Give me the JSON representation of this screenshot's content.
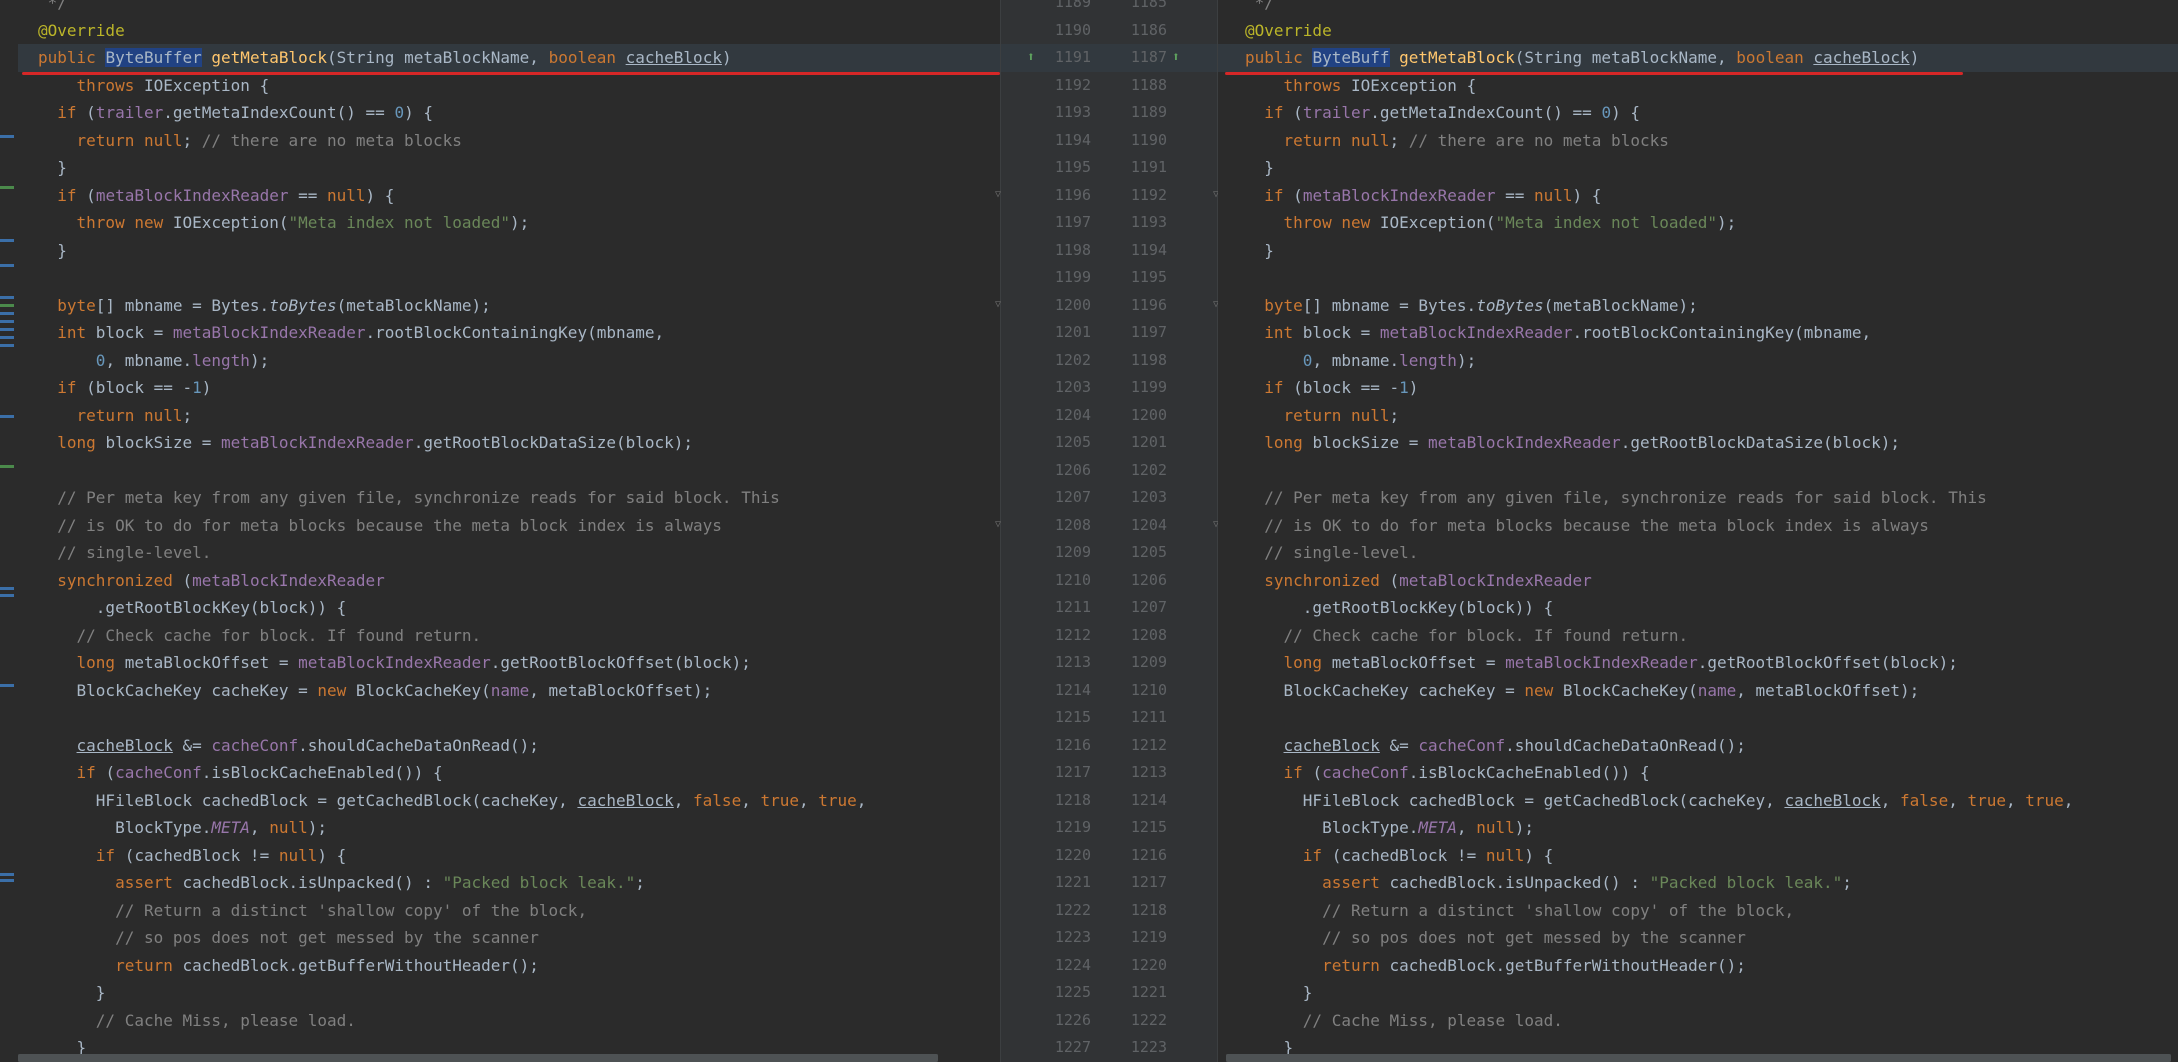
{
  "left": {
    "lines": [
      [
        {
          "t": " */",
          "c": "cm"
        }
      ],
      [
        {
          "t": "@Override",
          "c": "an"
        }
      ],
      [
        {
          "t": "public ",
          "c": "kw"
        },
        {
          "t": "ByteBuffer",
          "c": "sel"
        },
        {
          "t": " "
        },
        {
          "t": "getMetaBlock",
          "c": "fn"
        },
        {
          "t": "(String metaBlockName, "
        },
        {
          "t": "boolean ",
          "c": "kw"
        },
        {
          "t": "cacheBlock",
          "c": "ul"
        },
        {
          "t": ")"
        }
      ],
      [
        {
          "t": "    throws ",
          "c": "kw"
        },
        {
          "t": "IOException {"
        }
      ],
      [
        {
          "t": "  "
        },
        {
          "t": "if ",
          "c": "kw"
        },
        {
          "t": "("
        },
        {
          "t": "trailer",
          "c": "fld"
        },
        {
          "t": ".getMetaIndexCount() == "
        },
        {
          "t": "0",
          "c": "nm"
        },
        {
          "t": ") {"
        }
      ],
      [
        {
          "t": "    "
        },
        {
          "t": "return null",
          "c": "kw"
        },
        {
          "t": "; "
        },
        {
          "t": "// there are no meta blocks",
          "c": "cm"
        }
      ],
      [
        {
          "t": "  }"
        }
      ],
      [
        {
          "t": "  "
        },
        {
          "t": "if ",
          "c": "kw"
        },
        {
          "t": "("
        },
        {
          "t": "metaBlockIndexReader",
          "c": "fld"
        },
        {
          "t": " == "
        },
        {
          "t": "null",
          "c": "kw"
        },
        {
          "t": ") {"
        }
      ],
      [
        {
          "t": "    "
        },
        {
          "t": "throw new ",
          "c": "kw"
        },
        {
          "t": "IOException("
        },
        {
          "t": "\"Meta index not loaded\"",
          "c": "st"
        },
        {
          "t": ");"
        }
      ],
      [
        {
          "t": "  }"
        }
      ],
      [],
      [
        {
          "t": "  "
        },
        {
          "t": "byte",
          "c": "kw"
        },
        {
          "t": "[] mbname = Bytes."
        },
        {
          "t": "toBytes",
          "c": "it"
        },
        {
          "t": "(metaBlockName);"
        }
      ],
      [
        {
          "t": "  "
        },
        {
          "t": "int ",
          "c": "kw"
        },
        {
          "t": "block = "
        },
        {
          "t": "metaBlockIndexReader",
          "c": "fld"
        },
        {
          "t": ".rootBlockContainingKey(mbname,"
        }
      ],
      [
        {
          "t": "      "
        },
        {
          "t": "0",
          "c": "nm"
        },
        {
          "t": ", mbname."
        },
        {
          "t": "length",
          "c": "fld"
        },
        {
          "t": ");"
        }
      ],
      [
        {
          "t": "  "
        },
        {
          "t": "if ",
          "c": "kw"
        },
        {
          "t": "(block == -"
        },
        {
          "t": "1",
          "c": "nm"
        },
        {
          "t": ")"
        }
      ],
      [
        {
          "t": "    "
        },
        {
          "t": "return null",
          "c": "kw"
        },
        {
          "t": ";"
        }
      ],
      [
        {
          "t": "  "
        },
        {
          "t": "long ",
          "c": "kw"
        },
        {
          "t": "blockSize = "
        },
        {
          "t": "metaBlockIndexReader",
          "c": "fld"
        },
        {
          "t": ".getRootBlockDataSize(block);"
        }
      ],
      [],
      [
        {
          "t": "  "
        },
        {
          "t": "// Per meta key from any given file, synchronize reads for said block. This",
          "c": "cm"
        }
      ],
      [
        {
          "t": "  "
        },
        {
          "t": "// is OK to do for meta blocks because the meta block index is always",
          "c": "cm"
        }
      ],
      [
        {
          "t": "  "
        },
        {
          "t": "// single-level.",
          "c": "cm"
        }
      ],
      [
        {
          "t": "  "
        },
        {
          "t": "synchronized ",
          "c": "kw"
        },
        {
          "t": "("
        },
        {
          "t": "metaBlockIndexReader",
          "c": "fld"
        }
      ],
      [
        {
          "t": "      .getRootBlockKey(block)) {"
        }
      ],
      [
        {
          "t": "    "
        },
        {
          "t": "// Check cache for block. If found return.",
          "c": "cm"
        }
      ],
      [
        {
          "t": "    "
        },
        {
          "t": "long ",
          "c": "kw"
        },
        {
          "t": "metaBlockOffset = "
        },
        {
          "t": "metaBlockIndexReader",
          "c": "fld"
        },
        {
          "t": ".getRootBlockOffset(block);"
        }
      ],
      [
        {
          "t": "    BlockCacheKey cacheKey = "
        },
        {
          "t": "new ",
          "c": "kw"
        },
        {
          "t": "BlockCacheKey("
        },
        {
          "t": "name",
          "c": "fld"
        },
        {
          "t": ", metaBlockOffset);"
        }
      ],
      [],
      [
        {
          "t": "    "
        },
        {
          "t": "cacheBlock",
          "c": "ul"
        },
        {
          "t": " &= "
        },
        {
          "t": "cacheConf",
          "c": "fld"
        },
        {
          "t": ".shouldCacheDataOnRead();"
        }
      ],
      [
        {
          "t": "    "
        },
        {
          "t": "if ",
          "c": "kw"
        },
        {
          "t": "("
        },
        {
          "t": "cacheConf",
          "c": "fld"
        },
        {
          "t": ".isBlockCacheEnabled()) {"
        }
      ],
      [
        {
          "t": "      HFileBlock cachedBlock = getCachedBlock(cacheKey, "
        },
        {
          "t": "cacheBlock",
          "c": "ul"
        },
        {
          "t": ", "
        },
        {
          "t": "false",
          "c": "kw"
        },
        {
          "t": ", "
        },
        {
          "t": "true",
          "c": "kw"
        },
        {
          "t": ", "
        },
        {
          "t": "true",
          "c": "kw"
        },
        {
          "t": ","
        }
      ],
      [
        {
          "t": "        BlockType."
        },
        {
          "t": "META",
          "c": "fld it"
        },
        {
          "t": ", "
        },
        {
          "t": "null",
          "c": "kw"
        },
        {
          "t": ");"
        }
      ],
      [
        {
          "t": "      "
        },
        {
          "t": "if ",
          "c": "kw"
        },
        {
          "t": "(cachedBlock != "
        },
        {
          "t": "null",
          "c": "kw"
        },
        {
          "t": ") {"
        }
      ],
      [
        {
          "t": "        "
        },
        {
          "t": "assert ",
          "c": "kw"
        },
        {
          "t": "cachedBlock.isUnpacked() : "
        },
        {
          "t": "\"Packed block leak.\"",
          "c": "st"
        },
        {
          "t": ";"
        }
      ],
      [
        {
          "t": "        "
        },
        {
          "t": "// Return a distinct 'shallow copy' of the block,",
          "c": "cm"
        }
      ],
      [
        {
          "t": "        "
        },
        {
          "t": "// so pos does not get messed by the scanner",
          "c": "cm"
        }
      ],
      [
        {
          "t": "        "
        },
        {
          "t": "return ",
          "c": "kw"
        },
        {
          "t": "cachedBlock.getBufferWithoutHeader();"
        }
      ],
      [
        {
          "t": "      }"
        }
      ],
      [
        {
          "t": "      "
        },
        {
          "t": "// Cache Miss, please load.",
          "c": "cm"
        }
      ],
      [
        {
          "t": "    }"
        }
      ]
    ]
  },
  "right": {
    "lines": [
      [
        {
          "t": " */",
          "c": "cm"
        }
      ],
      [
        {
          "t": "@Override",
          "c": "an"
        }
      ],
      [
        {
          "t": "public ",
          "c": "kw"
        },
        {
          "t": "ByteBuff",
          "c": "sel"
        },
        {
          "t": " "
        },
        {
          "t": "getMetaBlock",
          "c": "fn"
        },
        {
          "t": "(String metaBlockName, "
        },
        {
          "t": "boolean ",
          "c": "kw"
        },
        {
          "t": "cacheBlock",
          "c": "ul"
        },
        {
          "t": ")"
        }
      ],
      [
        {
          "t": "    throws ",
          "c": "kw"
        },
        {
          "t": "IOException {"
        }
      ],
      [
        {
          "t": "  "
        },
        {
          "t": "if ",
          "c": "kw"
        },
        {
          "t": "("
        },
        {
          "t": "trailer",
          "c": "fld"
        },
        {
          "t": ".getMetaIndexCount() == "
        },
        {
          "t": "0",
          "c": "nm"
        },
        {
          "t": ") {"
        }
      ],
      [
        {
          "t": "    "
        },
        {
          "t": "return null",
          "c": "kw"
        },
        {
          "t": "; "
        },
        {
          "t": "// there are no meta blocks",
          "c": "cm"
        }
      ],
      [
        {
          "t": "  }"
        }
      ],
      [
        {
          "t": "  "
        },
        {
          "t": "if ",
          "c": "kw"
        },
        {
          "t": "("
        },
        {
          "t": "metaBlockIndexReader",
          "c": "fld"
        },
        {
          "t": " == "
        },
        {
          "t": "null",
          "c": "kw"
        },
        {
          "t": ") {"
        }
      ],
      [
        {
          "t": "    "
        },
        {
          "t": "throw new ",
          "c": "kw"
        },
        {
          "t": "IOException("
        },
        {
          "t": "\"Meta index not loaded\"",
          "c": "st"
        },
        {
          "t": ");"
        }
      ],
      [
        {
          "t": "  }"
        }
      ],
      [],
      [
        {
          "t": "  "
        },
        {
          "t": "byte",
          "c": "kw"
        },
        {
          "t": "[] mbname = Bytes."
        },
        {
          "t": "toBytes",
          "c": "it"
        },
        {
          "t": "(metaBlockName);"
        }
      ],
      [
        {
          "t": "  "
        },
        {
          "t": "int ",
          "c": "kw"
        },
        {
          "t": "block = "
        },
        {
          "t": "metaBlockIndexReader",
          "c": "fld"
        },
        {
          "t": ".rootBlockContainingKey(mbname,"
        }
      ],
      [
        {
          "t": "      "
        },
        {
          "t": "0",
          "c": "nm"
        },
        {
          "t": ", mbname."
        },
        {
          "t": "length",
          "c": "fld"
        },
        {
          "t": ");"
        }
      ],
      [
        {
          "t": "  "
        },
        {
          "t": "if ",
          "c": "kw"
        },
        {
          "t": "(block == -"
        },
        {
          "t": "1",
          "c": "nm"
        },
        {
          "t": ")"
        }
      ],
      [
        {
          "t": "    "
        },
        {
          "t": "return null",
          "c": "kw"
        },
        {
          "t": ";"
        }
      ],
      [
        {
          "t": "  "
        },
        {
          "t": "long ",
          "c": "kw"
        },
        {
          "t": "blockSize = "
        },
        {
          "t": "metaBlockIndexReader",
          "c": "fld"
        },
        {
          "t": ".getRootBlockDataSize(block);"
        }
      ],
      [],
      [
        {
          "t": "  "
        },
        {
          "t": "// Per meta key from any given file, synchronize reads for said block. This",
          "c": "cm"
        }
      ],
      [
        {
          "t": "  "
        },
        {
          "t": "// is OK to do for meta blocks because the meta block index is always",
          "c": "cm"
        }
      ],
      [
        {
          "t": "  "
        },
        {
          "t": "// single-level.",
          "c": "cm"
        }
      ],
      [
        {
          "t": "  "
        },
        {
          "t": "synchronized ",
          "c": "kw"
        },
        {
          "t": "("
        },
        {
          "t": "metaBlockIndexReader",
          "c": "fld"
        }
      ],
      [
        {
          "t": "      .getRootBlockKey(block)) {"
        }
      ],
      [
        {
          "t": "    "
        },
        {
          "t": "// Check cache for block. If found return.",
          "c": "cm"
        }
      ],
      [
        {
          "t": "    "
        },
        {
          "t": "long ",
          "c": "kw"
        },
        {
          "t": "metaBlockOffset = "
        },
        {
          "t": "metaBlockIndexReader",
          "c": "fld"
        },
        {
          "t": ".getRootBlockOffset(block);"
        }
      ],
      [
        {
          "t": "    BlockCacheKey cacheKey = "
        },
        {
          "t": "new ",
          "c": "kw"
        },
        {
          "t": "BlockCacheKey("
        },
        {
          "t": "name",
          "c": "fld"
        },
        {
          "t": ", metaBlockOffset);"
        }
      ],
      [],
      [
        {
          "t": "    "
        },
        {
          "t": "cacheBlock",
          "c": "ul"
        },
        {
          "t": " &= "
        },
        {
          "t": "cacheConf",
          "c": "fld"
        },
        {
          "t": ".shouldCacheDataOnRead();"
        }
      ],
      [
        {
          "t": "    "
        },
        {
          "t": "if ",
          "c": "kw"
        },
        {
          "t": "("
        },
        {
          "t": "cacheConf",
          "c": "fld"
        },
        {
          "t": ".isBlockCacheEnabled()) {"
        }
      ],
      [
        {
          "t": "      HFileBlock cachedBlock = getCachedBlock(cacheKey, "
        },
        {
          "t": "cacheBlock",
          "c": "ul"
        },
        {
          "t": ", "
        },
        {
          "t": "false",
          "c": "kw"
        },
        {
          "t": ", "
        },
        {
          "t": "true",
          "c": "kw"
        },
        {
          "t": ", "
        },
        {
          "t": "true",
          "c": "kw"
        },
        {
          "t": ","
        }
      ],
      [
        {
          "t": "        BlockType."
        },
        {
          "t": "META",
          "c": "fld it"
        },
        {
          "t": ", "
        },
        {
          "t": "null",
          "c": "kw"
        },
        {
          "t": ");"
        }
      ],
      [
        {
          "t": "      "
        },
        {
          "t": "if ",
          "c": "kw"
        },
        {
          "t": "(cachedBlock != "
        },
        {
          "t": "null",
          "c": "kw"
        },
        {
          "t": ") {"
        }
      ],
      [
        {
          "t": "        "
        },
        {
          "t": "assert ",
          "c": "kw"
        },
        {
          "t": "cachedBlock.isUnpacked() : "
        },
        {
          "t": "\"Packed block leak.\"",
          "c": "st"
        },
        {
          "t": ";"
        }
      ],
      [
        {
          "t": "        "
        },
        {
          "t": "// Return a distinct 'shallow copy' of the block,",
          "c": "cm"
        }
      ],
      [
        {
          "t": "        "
        },
        {
          "t": "// so pos does not get messed by the scanner",
          "c": "cm"
        }
      ],
      [
        {
          "t": "        "
        },
        {
          "t": "return ",
          "c": "kw"
        },
        {
          "t": "cachedBlock.getBufferWithoutHeader();"
        }
      ],
      [
        {
          "t": "      }"
        }
      ],
      [
        {
          "t": "      "
        },
        {
          "t": "// Cache Miss, please load.",
          "c": "cm"
        }
      ],
      [
        {
          "t": "    }"
        }
      ]
    ]
  },
  "gutter": {
    "left_numbers": [
      "1189",
      "1190",
      "1191",
      "1192",
      "1193",
      "1194",
      "1195",
      "1196",
      "1197",
      "1198",
      "1199",
      "1200",
      "1201",
      "1202",
      "1203",
      "1204",
      "1205",
      "1206",
      "1207",
      "1208",
      "1209",
      "1210",
      "1211",
      "1212",
      "1213",
      "1214",
      "1215",
      "1216",
      "1217",
      "1218",
      "1219",
      "1220",
      "1221",
      "1222",
      "1223",
      "1224",
      "1225",
      "1226",
      "1227"
    ],
    "right_numbers": [
      "1185",
      "1186",
      "1187",
      "1188",
      "1189",
      "1190",
      "1191",
      "1192",
      "1193",
      "1194",
      "1195",
      "1196",
      "1197",
      "1198",
      "1199",
      "1200",
      "1201",
      "1202",
      "1203",
      "1204",
      "1205",
      "1206",
      "1207",
      "1208",
      "1209",
      "1210",
      "1211",
      "1212",
      "1213",
      "1214",
      "1215",
      "1216",
      "1217",
      "1218",
      "1219",
      "1220",
      "1221",
      "1222",
      "1223"
    ],
    "change_icon": "override-arrow-up-icon"
  },
  "colors": {
    "background": "#2b2b2b",
    "gutter": "#313335",
    "keyword": "#cc7832",
    "annotation": "#bbb529",
    "method": "#ffc66d",
    "field": "#9876aa",
    "string": "#6a8759",
    "number": "#6897bb",
    "comment": "#808080",
    "diff_line": "#d62727",
    "selection": "#214283"
  }
}
